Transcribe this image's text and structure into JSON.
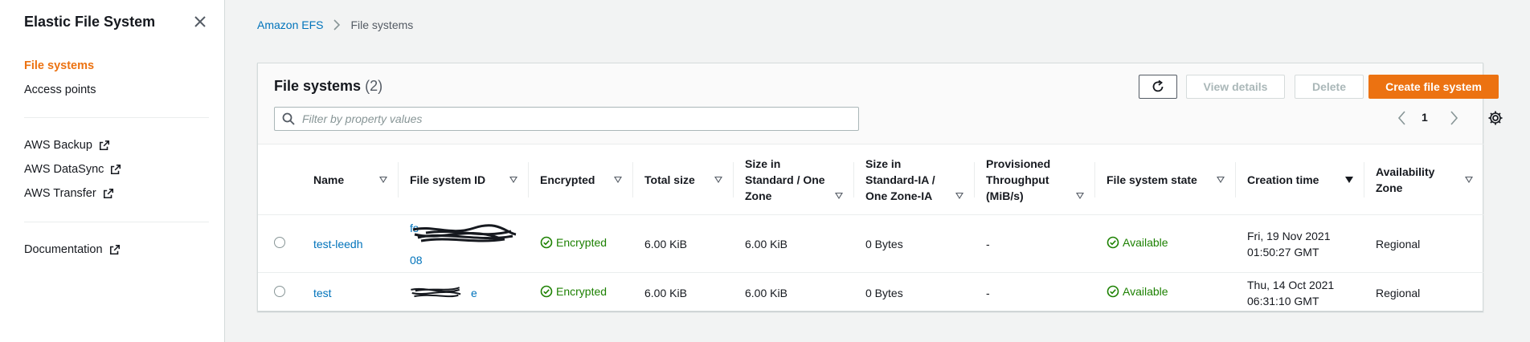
{
  "sidebar": {
    "title": "Elastic File System",
    "items": [
      {
        "label": "File systems",
        "active": true
      },
      {
        "label": "Access points",
        "active": false
      }
    ],
    "external_links": [
      {
        "label": "AWS Backup",
        "icon": "external-link-icon"
      },
      {
        "label": "AWS DataSync",
        "icon": "external-link-icon"
      },
      {
        "label": "AWS Transfer",
        "icon": "external-link-icon"
      }
    ],
    "docs": {
      "label": "Documentation",
      "icon": "external-link-icon"
    }
  },
  "breadcrumb": {
    "root": "Amazon EFS",
    "current": "File systems"
  },
  "panel": {
    "title": "File systems",
    "count": "(2)",
    "buttons": {
      "refresh_icon": "refresh-icon",
      "view_details": "View details",
      "delete": "Delete",
      "create": "Create file system"
    },
    "filter_placeholder": "Filter by property values",
    "page": "1"
  },
  "table": {
    "columns": [
      "Name",
      "File system ID",
      "Encrypted",
      "Total size",
      "Size in Standard / One Zone",
      "Size in Standard-IA / One Zone-IA",
      "Provisioned Throughput (MiB/s)",
      "File system state",
      "Creation time",
      "Availability Zone"
    ],
    "sorted_column": "Creation time",
    "rows": [
      {
        "name": "test-leedh",
        "id_top": "fs-",
        "id_bottom": "08",
        "encrypted": "Encrypted",
        "total_size": "6.00 KiB",
        "size_standard": "6.00 KiB",
        "size_ia": "0 Bytes",
        "throughput": "-",
        "state": "Available",
        "created_line1": "Fri, 19 Nov 2021",
        "created_line2": "01:50:27 GMT",
        "az": "Regional"
      },
      {
        "name": "test",
        "id_top": "e",
        "id_bottom": "",
        "encrypted": "Encrypted",
        "total_size": "6.00 KiB",
        "size_standard": "6.00 KiB",
        "size_ia": "0 Bytes",
        "throughput": "-",
        "state": "Available",
        "created_line1": "Thu, 14 Oct 2021",
        "created_line2": "06:31:10 GMT",
        "az": "Regional"
      }
    ]
  },
  "colors": {
    "accent": "#ec7211",
    "link": "#0073bb",
    "success": "#1d8102"
  }
}
